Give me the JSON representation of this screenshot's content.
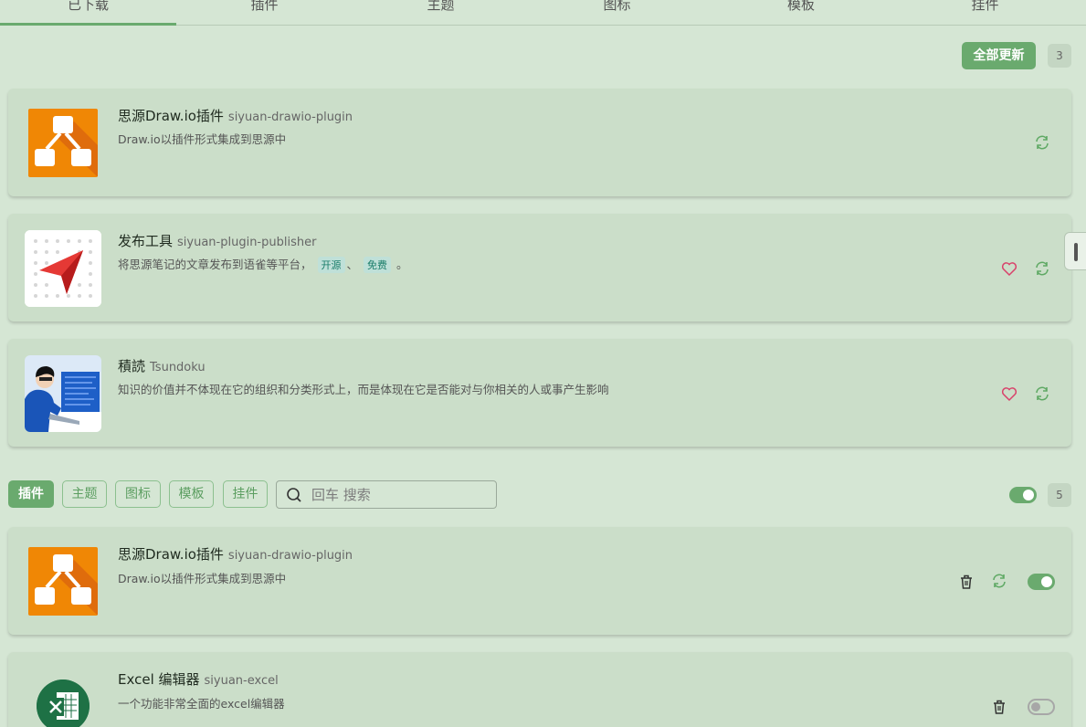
{
  "tabs": [
    "已下载",
    "插件",
    "主题",
    "图标",
    "模板",
    "挂件"
  ],
  "updates": {
    "update_all_label": "全部更新",
    "count": "3",
    "items": [
      {
        "name": "思源Draw.io插件",
        "package": "siyuan-drawio-plugin",
        "desc": "Draw.io以插件形式集成到思源中"
      },
      {
        "name": "发布工具",
        "package": "siyuan-plugin-publisher",
        "desc": "将思源笔记的文章发布到语雀等平台，",
        "tags": [
          "开源",
          "免费"
        ],
        "desc_sep": "、",
        "desc_end": "。"
      },
      {
        "name": "積読",
        "package": "Tsundoku",
        "desc": "知识的价值并不体现在它的组织和分类形式上，而是体现在它是否能对与你相关的人或事产生影响"
      }
    ]
  },
  "filters": {
    "buttons": [
      "插件",
      "主题",
      "图标",
      "模板",
      "挂件"
    ],
    "active": "插件",
    "search_placeholder": "回车 搜索",
    "count": "5"
  },
  "installed": [
    {
      "name": "思源Draw.io插件",
      "package": "siyuan-drawio-plugin",
      "desc": "Draw.io以插件形式集成到思源中",
      "enabled": true
    },
    {
      "name": "Excel 编辑器",
      "package": "siyuan-excel",
      "desc": "一个功能非常全面的excel编辑器",
      "enabled": false
    }
  ],
  "icons": {
    "update": "refresh-icon",
    "favorite": "heart-icon",
    "delete": "trash-icon",
    "search": "search-icon"
  },
  "colors": {
    "accent": "#6aaa6e",
    "background": "#d5e6d4",
    "card": "#cbdec9",
    "heart": "#d9416a",
    "drawio_orange": "#f08705"
  }
}
